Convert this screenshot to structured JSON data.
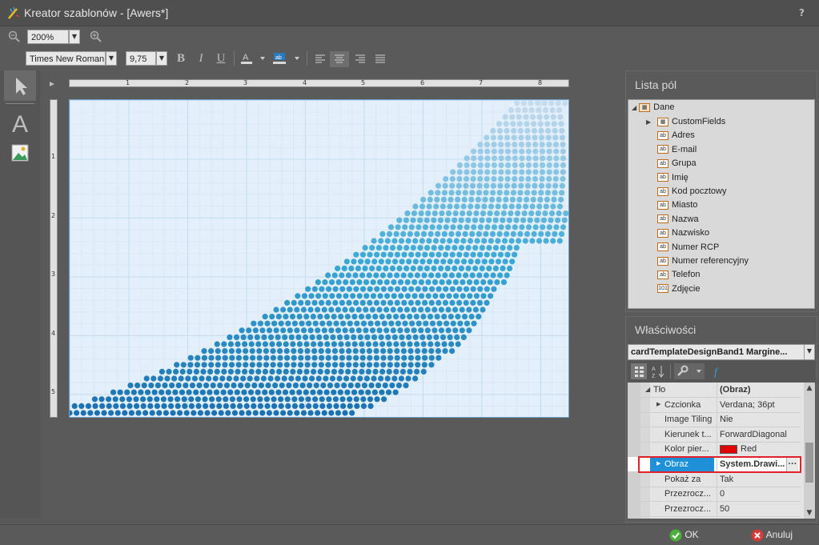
{
  "window": {
    "title": "Kreator szablonów - [Awers*]",
    "help_label": "?"
  },
  "toolbar": {
    "zoom_value": "200%",
    "font_name": "Times New Roman",
    "font_size": "9,75",
    "bold": "B",
    "italic": "I",
    "underline": "U"
  },
  "ruler": {
    "top_numbers": [
      "1",
      "2",
      "3",
      "4",
      "5",
      "6",
      "7",
      "8"
    ],
    "left_numbers": [
      "1",
      "2",
      "3",
      "4",
      "5"
    ]
  },
  "fields_panel": {
    "title": "Lista pól",
    "root": "Dane",
    "items": [
      {
        "label": "CustomFields",
        "icon": "table-icon"
      },
      {
        "label": "Adres",
        "icon": "text-field-icon"
      },
      {
        "label": "E-mail",
        "icon": "text-field-icon"
      },
      {
        "label": "Grupa",
        "icon": "text-field-icon"
      },
      {
        "label": "Imię",
        "icon": "text-field-icon"
      },
      {
        "label": "Kod pocztowy",
        "icon": "text-field-icon"
      },
      {
        "label": "Miasto",
        "icon": "text-field-icon"
      },
      {
        "label": "Nazwa",
        "icon": "text-field-icon"
      },
      {
        "label": "Nazwisko",
        "icon": "text-field-icon"
      },
      {
        "label": "Numer RCP",
        "icon": "text-field-icon"
      },
      {
        "label": "Numer referencyjny",
        "icon": "text-field-icon"
      },
      {
        "label": "Telefon",
        "icon": "text-field-icon"
      },
      {
        "label": "Zdjęcie",
        "icon": "binary-field-icon"
      }
    ]
  },
  "properties_panel": {
    "title": "Właściwości",
    "selected_object": "cardTemplateDesignBand1  Margine...",
    "rows": [
      {
        "name": "Tło",
        "value": "(Obraz)"
      },
      {
        "name": "Czcionka",
        "value": "Verdana; 36pt"
      },
      {
        "name": "Image Tiling",
        "value": "Nie"
      },
      {
        "name": "Kierunek t...",
        "value": "ForwardDiagonal"
      },
      {
        "name": "Kolor pier...",
        "value": "Red"
      },
      {
        "name": "Obraz",
        "value": "System.Drawi..."
      },
      {
        "name": "Pokaż za",
        "value": "Tak"
      },
      {
        "name": "Przezrocz...",
        "value": "0"
      },
      {
        "name": "Przezrocz...",
        "value": "50"
      }
    ],
    "ellipsis": "···"
  },
  "footer": {
    "ok_label": "OK",
    "cancel_label": "Anuluj"
  },
  "colors": {
    "selection": "#1e90d8",
    "highlight_border": "#e0202a",
    "swatch_red": "#e00000",
    "dot_dark": "#1a6fb0",
    "dot_light": "#c9dcee"
  }
}
